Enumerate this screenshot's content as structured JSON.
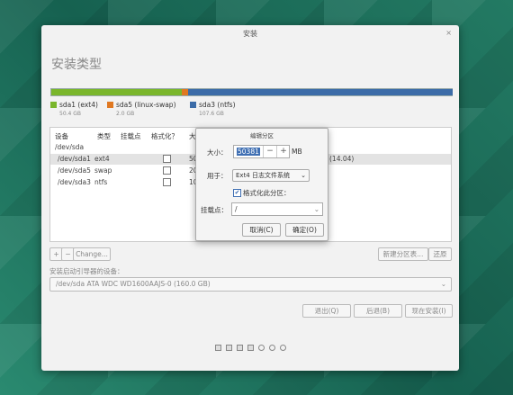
{
  "window": {
    "title": "安装",
    "close": "×"
  },
  "heading": "安装类型",
  "partitions_bar": {
    "segments": [
      {
        "fraction": 0.325,
        "color": "#7ab62c"
      },
      {
        "fraction": 0.015,
        "color": "#e07821"
      },
      {
        "fraction": 0.66,
        "color": "#3c6ca8"
      }
    ]
  },
  "legend": [
    {
      "label": "sda1 (ext4)",
      "size": "50.4 GB",
      "color": "#7ab62c"
    },
    {
      "label": "sda5 (linux-swap)",
      "size": "2.0 GB",
      "color": "#e07821"
    },
    {
      "label": "sda3 (ntfs)",
      "size": "107.6 GB",
      "color": "#3c6ca8"
    }
  ],
  "table": {
    "headers": [
      "设备",
      "类型",
      "挂载点",
      "格式化？",
      "大"
    ],
    "disk": "/dev/sda",
    "rows": [
      {
        "device": "/dev/sda1",
        "type": "ext4",
        "size": "50",
        "extra": "(14.04)"
      },
      {
        "device": "/dev/sda5",
        "type": "swap",
        "size": "20",
        "extra": ""
      },
      {
        "device": "/dev/sda3",
        "type": "ntfs",
        "size": "10",
        "extra": ""
      }
    ]
  },
  "toolbar": {
    "add": "+",
    "remove": "−",
    "change": "Change...",
    "new_table": "新建分区表...",
    "revert": "还原"
  },
  "boot": {
    "label": "安装启动引导器的设备：",
    "value": "/dev/sda   ATA WDC WD1600AAJS-0 (160.0 GB)"
  },
  "nav": {
    "quit": "退出(Q)",
    "back": "后退(B)",
    "install": "现在安装(I)"
  },
  "dialog": {
    "title": "编辑分区",
    "size_label": "大小：",
    "size_value": "50381",
    "minus": "−",
    "plus": "+",
    "unit": "MB",
    "use_label": "用于：",
    "use_value": "Ext4 日志文件系统",
    "format_label": "格式化此分区：",
    "mount_label": "挂载点：",
    "mount_value": "/",
    "cancel": "取消(C)",
    "ok": "确定(O)"
  }
}
